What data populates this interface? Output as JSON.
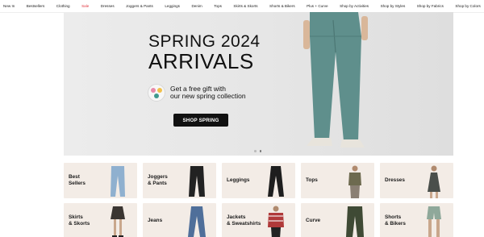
{
  "nav": {
    "items": [
      {
        "label": "New In"
      },
      {
        "label": "Bestsellers"
      },
      {
        "label": "Clothing"
      },
      {
        "label": "Sale"
      },
      {
        "label": "Dresses"
      },
      {
        "label": "Joggers & Pants"
      },
      {
        "label": "Leggings"
      },
      {
        "label": "Denim"
      },
      {
        "label": "Tops"
      },
      {
        "label": "Skirts & Skorts"
      },
      {
        "label": "Shorts & Bikers"
      },
      {
        "label": "Plus + Curve"
      },
      {
        "label": "Shop by Activities"
      },
      {
        "label": "Shop by Styles"
      },
      {
        "label": "Shop by Fabrics"
      },
      {
        "label": "Shop by Colors"
      }
    ],
    "sale_color": "#e0313b"
  },
  "hero": {
    "title_line1": "SPRING 2024",
    "title_line2": "ARRIVALS",
    "gift_line1": "Get a free gift with",
    "gift_line2": "our new spring collection",
    "cta_label": "SHOP SPRING",
    "pants_color": "#5f8f8c",
    "slide_count": 2,
    "active_slide": 1
  },
  "categories": {
    "tile_bg": "#f3ece6",
    "tiles": [
      {
        "label": "Best\nSellers",
        "item": "jeans",
        "color": "#8fb0cf"
      },
      {
        "label": "Joggers\n& Pants",
        "item": "pants",
        "color": "#222222"
      },
      {
        "label": "Leggings",
        "item": "leggings",
        "color": "#1e1e1e"
      },
      {
        "label": "Tops",
        "item": "top",
        "color": "#6d6a4f"
      },
      {
        "label": "Dresses",
        "item": "dress",
        "color": "#4a4f4b"
      },
      {
        "label": "Skirts\n& Skorts",
        "item": "skirt",
        "color": "#3a3531"
      },
      {
        "label": "Jeans",
        "item": "jeans",
        "color": "#4f6f9a"
      },
      {
        "label": "Jackets\n& Sweatshirts",
        "item": "jacket",
        "color": "#b03a3a"
      },
      {
        "label": "Curve",
        "item": "pants",
        "color": "#3f4a35"
      },
      {
        "label": "Shorts\n& Bikers",
        "item": "shorts",
        "color": "#8fa89a"
      }
    ]
  }
}
